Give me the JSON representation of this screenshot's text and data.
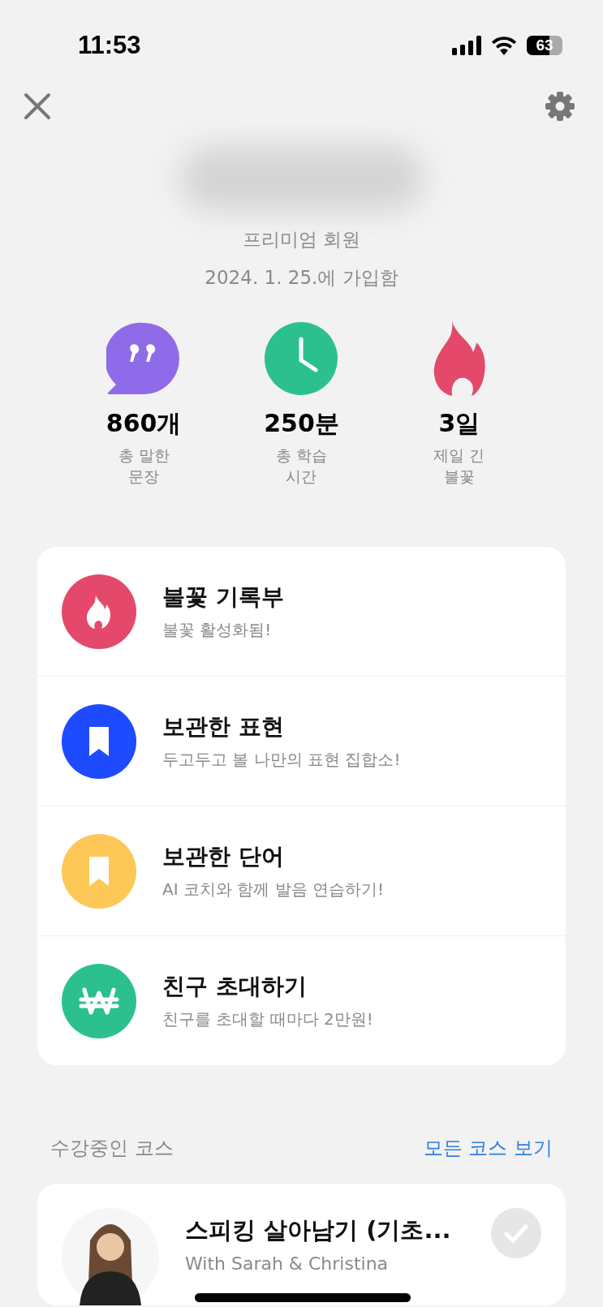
{
  "status_bar": {
    "time": "11:53",
    "battery": "63"
  },
  "profile": {
    "membership": "프리미엄 회원",
    "joined": "2024. 1. 25.에 가입함"
  },
  "stats": [
    {
      "kind": "quote",
      "color": "#8f6bea",
      "value": "860개",
      "label": "총 말한\n문장"
    },
    {
      "kind": "clock",
      "color": "#2cc08f",
      "value": "250분",
      "label": "총 학습\n시간"
    },
    {
      "kind": "flame",
      "color": "#e4496b",
      "value": "3일",
      "label": "제일 긴\n불꽃"
    }
  ],
  "menu": [
    {
      "kind": "flame",
      "color": "#e4496b",
      "title": "불꽃 기록부",
      "subtitle": "불꽃 활성화됨!"
    },
    {
      "kind": "bookmark",
      "color": "#1f4bff",
      "title": "보관한 표현",
      "subtitle": "두고두고 볼 나만의 표현 집합소!"
    },
    {
      "kind": "bookmark",
      "color": "#fdc858",
      "title": "보관한 단어",
      "subtitle": "AI 코치와 함께 발음 연습하기!"
    },
    {
      "kind": "won",
      "color": "#2cc08f",
      "title": "친구 초대하기",
      "subtitle": "친구를 초대할 때마다 2만원!"
    }
  ],
  "courses_section": {
    "title": "수강중인 코스",
    "link": "모든 코스 보기"
  },
  "courses": [
    {
      "title": "스피킹 살아남기 (기초...",
      "subtitle": "With Sarah & Christina",
      "checked": false
    }
  ]
}
